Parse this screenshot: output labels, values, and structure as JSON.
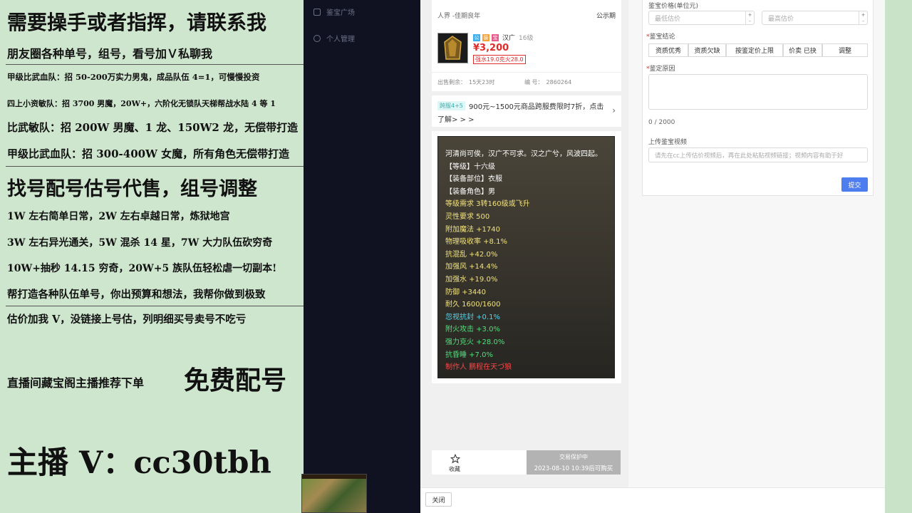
{
  "overlay": {
    "lines": [
      "需要操手或者指挥，请联系我",
      "朋友圈各种单号，组号，看号加Ｖ私聊我",
      "甲级比武血队：招 50-200万实力男鬼，成品队伍 4=1，可慢慢投资",
      "四上小资敏队：招 3700 男魔，20W+，六阶化无锁队天梯帮战水陆 4 等 1",
      "比武敏队：招 200W 男魔、1 龙、150W2 龙，无偿带打造",
      "甲级比武血队：招 300-400W 女魔，所有角色无偿带打造",
      "找号配号估号代售，组号调整",
      "1W 左右简单日常，2W 左右卓越日常，炼狱地宫",
      "3W 左右异光通关，5W 混杀 14 星，7W 大力队伍砍穷奇",
      "10W+抽秒 14.15 穷奇，20W+5 族队伍轻松虐一切副本!",
      "帮打造各种队伍单号，你出预算和想法，我帮你做到极致",
      "估价加我 V，没链接上号估，列明细买号卖号不吃亏",
      "直播间藏宝阁主播推荐下单",
      "免费配号",
      "主播 V：cc30tbh"
    ]
  },
  "nav": {
    "items": [
      "鉴宝广场",
      "个人管理"
    ]
  },
  "item": {
    "server": "人界 -佳期良年",
    "status": "公示期",
    "badges": [
      "公",
      "装",
      "宝"
    ],
    "faction": "汉广",
    "level": "16级",
    "price": "¥3,200",
    "attr_tag": "强水19.0克火28.0",
    "remaining_label": "出售剩余：",
    "remaining": "15天23时",
    "serial_label": "编 号：",
    "serial": "2860264",
    "promo_tag": "跨服4+5",
    "promo_text_1": "900元~1500元商品跨服费限时7折，点击",
    "promo_text_2": "了解> > >",
    "desc_lines": [
      {
        "text": "河清尚可俟，汉广不可求。汉之广兮，风波四起。",
        "color": "#ffffff"
      },
      {
        "text": "【等级】十六级",
        "color": "#ffffff"
      },
      {
        "text": "【装备部位】衣服",
        "color": "#ffffff"
      },
      {
        "text": "【装备角色】男",
        "color": "#ffffff"
      },
      {
        "text": "等级需求 3转160级或飞升",
        "color": "#f2e27a"
      },
      {
        "text": "灵性要求 500",
        "color": "#f2e27a"
      },
      {
        "text": "附加魔法 +1740",
        "color": "#f2e27a"
      },
      {
        "text": "物理吸收率 +8.1%",
        "color": "#f2e27a"
      },
      {
        "text": "抗混乱 +42.0%",
        "color": "#f2e27a"
      },
      {
        "text": "加强风 +14.4%",
        "color": "#f2e27a"
      },
      {
        "text": "加强水 +19.0%",
        "color": "#f2e27a"
      },
      {
        "text": "防御 +3440",
        "color": "#f2e27a"
      },
      {
        "text": "耐久 1600/1600",
        "color": "#f2e27a"
      },
      {
        "text": "忽视抗封 +0.1%",
        "color": "#4fd6ef"
      },
      {
        "text": "附火攻击 +3.0%",
        "color": "#4ee07a"
      },
      {
        "text": "强力克火 +28.0%",
        "color": "#4ee07a"
      },
      {
        "text": "抗昏睡 +7.0%",
        "color": "#4ee07a"
      },
      {
        "text": "制作人 鹏程在天づ狼",
        "color": "#ef4a4a"
      }
    ],
    "favorite_label": "收藏",
    "protect_title": "交易保护中",
    "protect_time": "2023-08-10 10:39后可购买"
  },
  "form": {
    "price_label": "鉴宝价格(单位元)",
    "min_placeholder": "最低估价",
    "max_placeholder": "最高估价",
    "conclusion_label": "鉴宝结论",
    "tags": [
      "资质优秀",
      "资质欠缺",
      "按鉴定价上限",
      "价卖 已抉",
      "调整"
    ],
    "reason_label": "鉴定原因",
    "counter": "0 / 2000",
    "video_label": "上传鉴宝视频",
    "video_placeholder": "请先在cc上传估价视频后，再在此处粘贴视频链接；视频内容有助于好",
    "submit": "提交",
    "stepper_up": "+",
    "stepper_down": "-"
  },
  "footer": {
    "close": "关闭"
  },
  "colors": {
    "price": "#e02b2b",
    "submit": "#4e7df0",
    "nav_bg": "#101222",
    "overlay_bg": "#cfe6ce"
  }
}
